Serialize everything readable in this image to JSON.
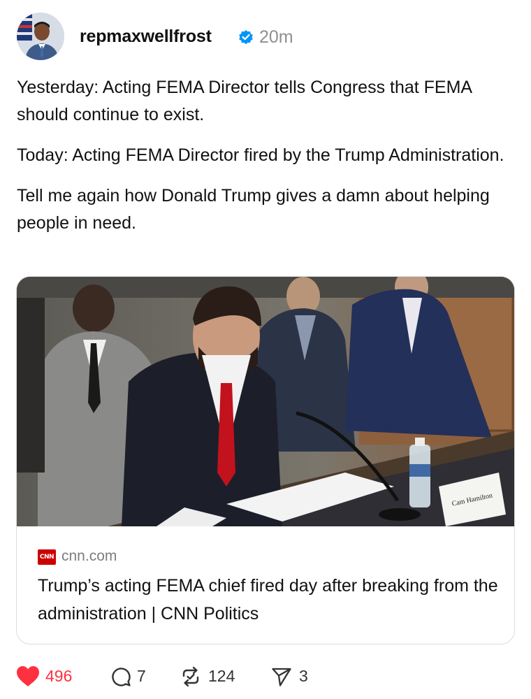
{
  "post": {
    "username": "repmaxwellfrost",
    "time": "20m",
    "paragraphs": [
      "Yesterday: Acting FEMA Director tells Congress that FEMA should continue to exist.",
      "Today: Acting FEMA Director fired by the Trump Administration.",
      "Tell me again how Donald Trump gives a damn about helping people in need."
    ]
  },
  "link_card": {
    "source_logo": "CNN",
    "domain": "cnn.com",
    "title": "Trump’s acting FEMA chief fired day after breaking from the administration | CNN Politics",
    "nameplate_text": "Cam Hamilton"
  },
  "actions": {
    "likes": "496",
    "replies": "7",
    "reposts": "124",
    "shares": "3"
  },
  "colors": {
    "like": "#ff3040",
    "verified": "#0095f6",
    "muted": "#8f8f8f"
  },
  "icons": [
    "verified-badge-icon",
    "heart-icon",
    "comment-icon",
    "repost-icon",
    "share-icon",
    "cnn-logo-icon"
  ]
}
